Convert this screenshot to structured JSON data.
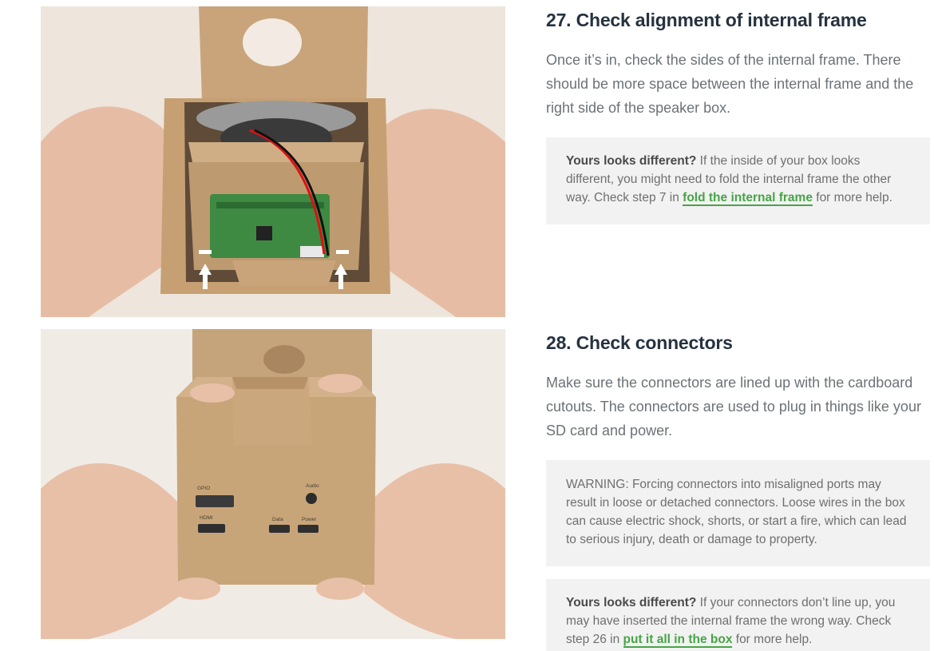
{
  "step27": {
    "title": "27. Check alignment of internal frame",
    "body": "Once it’s in, check the sides of the internal frame. There should be more space between the internal frame and the right side of the speaker box.",
    "note_lead": "Yours looks different?",
    "note_text_before": " If the inside of your box looks different, you might need to fold the internal frame the other way. Check step 7 in ",
    "note_link": "fold the internal frame",
    "note_text_after": " for more help."
  },
  "step28": {
    "title": "28. Check connectors",
    "body": "Make sure the connectors are lined up with the cardboard cutouts. The connectors are used to plug in things like your SD card and power.",
    "warning": "WARNING: Forcing connectors into misaligned ports may result in loose or detached connectors. Loose wires in the box can cause electric shock, shorts, or start a fire, which can lead to serious injury, death or damage to property.",
    "note_lead": "Yours looks different?",
    "note_text_before": " If your connectors don’t line up, you may have inserted the internal frame the wrong way. Check step 26 in ",
    "note_link": "put it all in the box",
    "note_text_after": " for more help."
  },
  "box_labels": {
    "gpio": "GPIO",
    "audio": "Audio",
    "hdmi": "HDMI",
    "data": "Data",
    "power": "Power"
  },
  "colors": {
    "link": "#47a447",
    "heading": "#26323f",
    "body_text": "#6c7277",
    "note_bg": "#f2f2f2",
    "cardboard": "#c9a57a"
  }
}
